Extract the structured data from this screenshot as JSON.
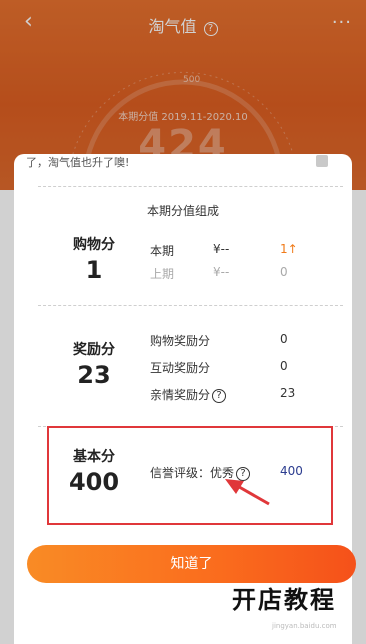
{
  "nav": {
    "back_icon": "chevron-left-icon",
    "title": "淘气值",
    "help_glyph": "?",
    "more_glyph": "···"
  },
  "gauge": {
    "tick_500": "500",
    "period": "本期分值 2019.11-2020.10",
    "score": "424"
  },
  "notice": {
    "text": "了，淘气值也升了噢!"
  },
  "breakdown": {
    "title": "本期分值组成",
    "shopping": {
      "label": "购物分",
      "value": "1",
      "rows": [
        {
          "label": "本期",
          "currency": "¥--",
          "value": "1↑"
        },
        {
          "label": "上期",
          "currency": "¥--",
          "value": "0"
        }
      ]
    },
    "reward": {
      "label": "奖励分",
      "value": "23",
      "rows": [
        {
          "label": "购物奖励分",
          "value": "0"
        },
        {
          "label": "互动奖励分",
          "value": "0"
        },
        {
          "label": "亲情奖励分",
          "value": "23"
        }
      ]
    },
    "basic": {
      "label": "基本分",
      "value": "400",
      "credit_label": "信誉评级：优秀",
      "credit_value": "400"
    }
  },
  "button": {
    "label": "知道了"
  },
  "watermark": {
    "text": "开店教程",
    "sub": "jingyan.baidu.com"
  },
  "colors": {
    "header": "#e06a2c",
    "accent": "#f07a19",
    "highlight_box": "#e0373a",
    "button": "#fa6b1d"
  }
}
